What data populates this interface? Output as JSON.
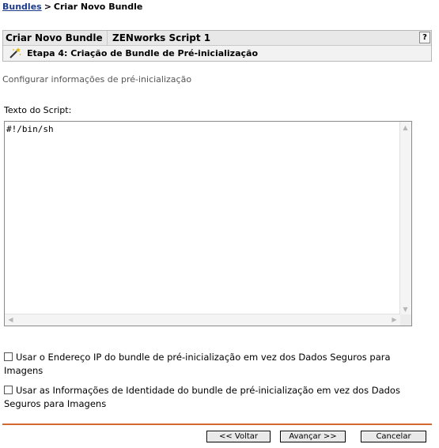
{
  "breadcrumb": {
    "link": "Bundles",
    "separator": ">",
    "current": "Criar Novo Bundle"
  },
  "panel": {
    "title": "Criar Novo Bundle",
    "bundle_name": "ZENworks Script 1",
    "help_label": "?",
    "step_icon": "wand-icon",
    "step_title": "Etapa 4: Criação de Bundle de Pré-inicialização"
  },
  "subtitle": "Configurar informações de pré-inicialização",
  "script": {
    "label": "Texto do Script:",
    "value": "#!/bin/sh"
  },
  "options": [
    {
      "label": "Usar o Endereço IP do bundle de pré-inicialização em vez dos Dados Seguros para Imagens",
      "checked": false
    },
    {
      "label": "Usar as Informações de Identidade do bundle de pré-inicialização em vez dos Dados Seguros para Imagens",
      "checked": false
    }
  ],
  "buttons": {
    "back": "<< Voltar",
    "next": "Avançar >>",
    "cancel": "Cancelar"
  },
  "colors": {
    "link": "#1c3b8a",
    "footer_rule": "#d4662f",
    "header_bg": "#e8e8e8"
  }
}
